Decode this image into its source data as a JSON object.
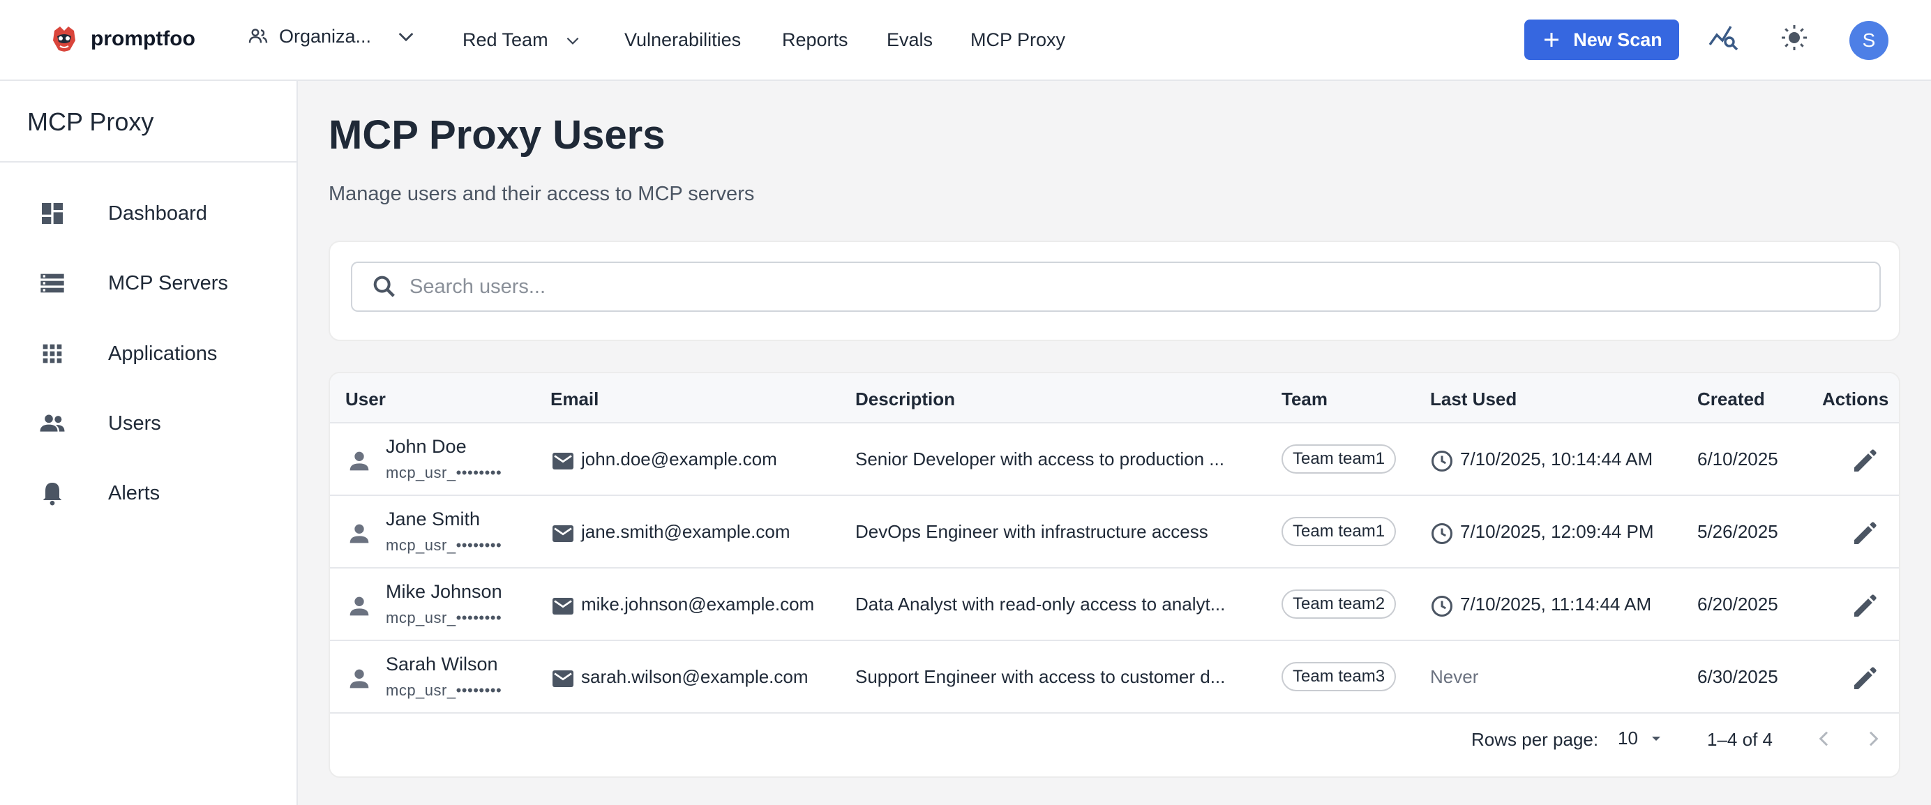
{
  "header": {
    "brand": "promptfoo",
    "org_label": "Organiza...",
    "nav": [
      "Red Team",
      "Vulnerabilities",
      "Reports",
      "Evals",
      "MCP Proxy"
    ],
    "new_scan_label": "New Scan",
    "avatar_initial": "S"
  },
  "sidebar": {
    "title": "MCP Proxy",
    "items": [
      {
        "label": "Dashboard",
        "icon": "dashboard-icon"
      },
      {
        "label": "MCP Servers",
        "icon": "servers-icon"
      },
      {
        "label": "Applications",
        "icon": "apps-grid-icon"
      },
      {
        "label": "Users",
        "icon": "users-icon"
      },
      {
        "label": "Alerts",
        "icon": "bell-icon"
      }
    ]
  },
  "main": {
    "title": "MCP Proxy Users",
    "subtitle": "Manage users and their access to MCP servers",
    "search_placeholder": "Search users...",
    "columns": [
      "User",
      "Email",
      "Description",
      "Team",
      "Last Used",
      "Created",
      "Actions"
    ],
    "rows": [
      {
        "name": "John Doe",
        "key": "mcp_usr_••••••••",
        "email": "john.doe@example.com",
        "description": "Senior Developer with access to production ...",
        "team": "Team team1",
        "last_used": "7/10/2025, 10:14:44 AM",
        "created": "6/10/2025"
      },
      {
        "name": "Jane Smith",
        "key": "mcp_usr_••••••••",
        "email": "jane.smith@example.com",
        "description": "DevOps Engineer with infrastructure access",
        "team": "Team team1",
        "last_used": "7/10/2025, 12:09:44 PM",
        "created": "5/26/2025"
      },
      {
        "name": "Mike Johnson",
        "key": "mcp_usr_••••••••",
        "email": "mike.johnson@example.com",
        "description": "Data Analyst with read-only access to analyt...",
        "team": "Team team2",
        "last_used": "7/10/2025, 11:14:44 AM",
        "created": "6/20/2025"
      },
      {
        "name": "Sarah Wilson",
        "key": "mcp_usr_••••••••",
        "email": "sarah.wilson@example.com",
        "description": "Support Engineer with access to customer d...",
        "team": "Team team3",
        "last_used": "Never",
        "created": "6/30/2025"
      }
    ],
    "pagination": {
      "rows_per_page_label": "Rows per page:",
      "rows_per_page": "10",
      "range": "1–4 of 4"
    }
  },
  "colors": {
    "accent": "#3667e0",
    "avatar": "#4d7fe6"
  }
}
